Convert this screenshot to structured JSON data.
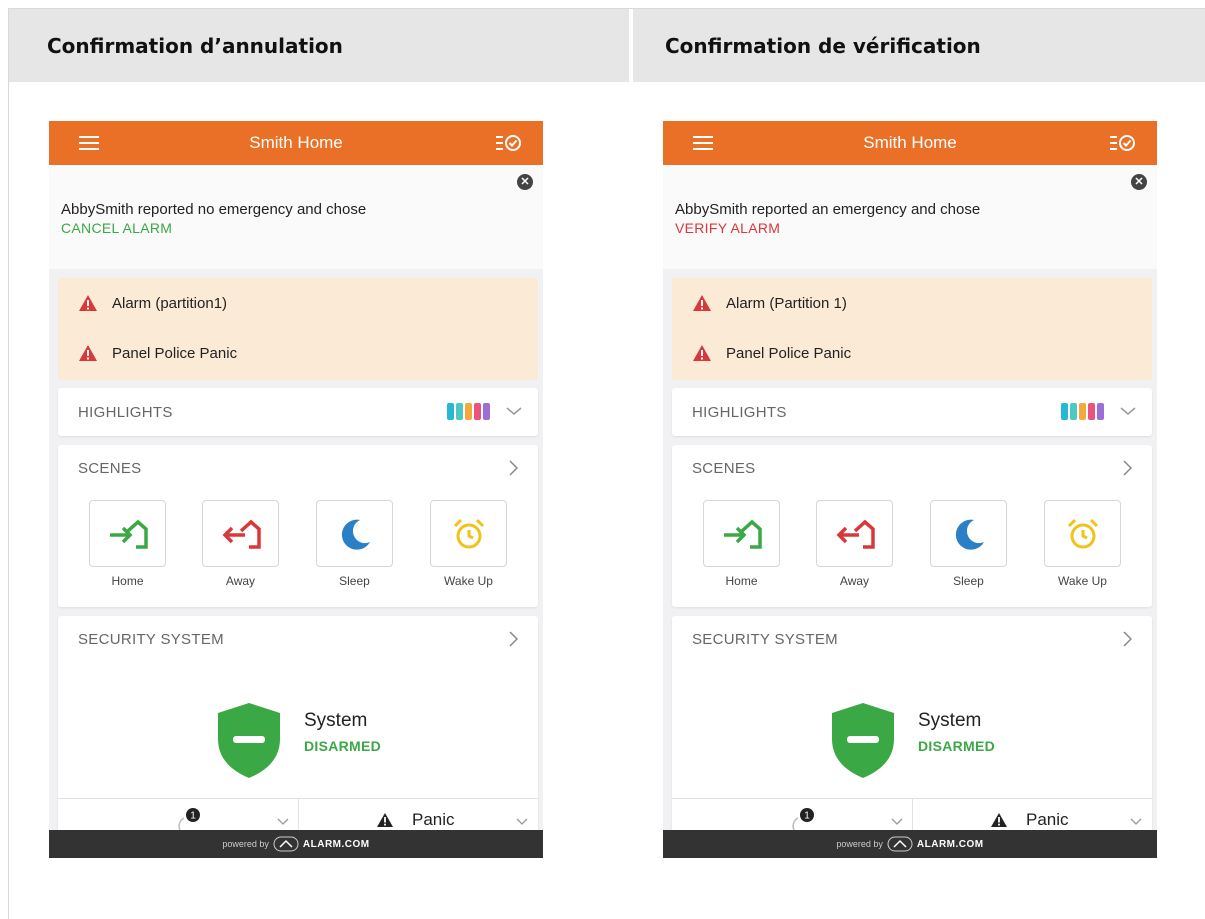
{
  "headers": {
    "left": "Confirmation d’annulation",
    "right": "Confirmation de vérification"
  },
  "colors": {
    "topbar": "#e97026",
    "alarm_bg": "#fbebd6",
    "cancel_green": "#3aa845",
    "verify_red": "#d9383a",
    "footer": "#333333"
  },
  "phones": [
    {
      "app_title": "Smith Home",
      "notice": {
        "text": "AbbySmith reported no emergency and chose",
        "status": "CANCEL ALARM"
      },
      "alarms": [
        "Alarm (partition1)",
        "Panel Police Panic"
      ],
      "highlights_label": "HIGHLIGHTS",
      "scenes_label": "SCENES",
      "scenes": [
        "Home",
        "Away",
        "Sleep",
        "Wake Up"
      ],
      "security_label": "SECURITY SYSTEM",
      "system_name": "System",
      "system_state": "DISARMED",
      "sensor_badge": "1",
      "panic_label": "Panic",
      "footer": {
        "powered": "powered by",
        "brand": "ALARM.COM"
      }
    },
    {
      "app_title": "Smith Home",
      "notice": {
        "text": "AbbySmith reported an emergency and chose",
        "status": "VERIFY ALARM"
      },
      "alarms": [
        "Alarm (Partition 1)",
        "Panel Police Panic"
      ],
      "highlights_label": "HIGHLIGHTS",
      "scenes_label": "SCENES",
      "scenes": [
        "Home",
        "Away",
        "Sleep",
        "Wake Up"
      ],
      "security_label": "SECURITY SYSTEM",
      "system_name": "System",
      "system_state": "DISARMED",
      "sensor_badge": "1",
      "panic_label": "Panic",
      "footer": {
        "powered": "powered by",
        "brand": "ALARM.COM"
      }
    }
  ]
}
